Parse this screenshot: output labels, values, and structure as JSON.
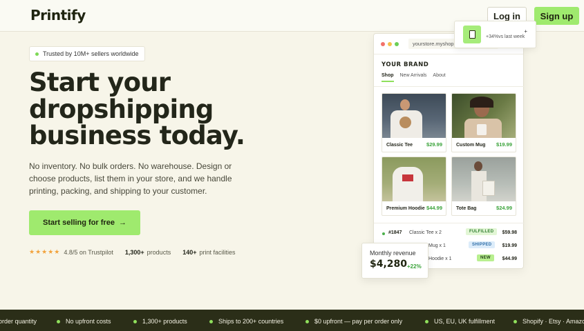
{
  "header": {
    "logo": "Printify",
    "login_label": "Log in",
    "signup_label": "Sign up"
  },
  "hero": {
    "trust_badge": "Trusted by 10M+ sellers worldwide",
    "headline_lines": [
      "Start your",
      "dropshipping",
      "business today."
    ],
    "subtext": "No inventory. No bulk orders. No warehouse. Design or choose products, list them in your store, and we handle printing, packing, and shipping to your customer.",
    "cta_label": "Start selling for free",
    "cta_arrow": "→",
    "stars": "★★★★★",
    "rating_text": "4.8/5 on Trustpilot",
    "products_count": "1,300+",
    "products_label": "products",
    "facilities_count": "140+",
    "facilities_label": "print facilities"
  },
  "notification": {
    "text": "+34%vs last week",
    "plus": "+"
  },
  "store": {
    "url": "yourstore.myshopify.",
    "brand": "YOUR BRAND",
    "tabs": [
      "Shop",
      "New Arrivals",
      "About"
    ],
    "products": [
      {
        "name": "Classic Tee",
        "price": "$29.99"
      },
      {
        "name": "Custom Mug",
        "price": "$19.99"
      },
      {
        "name": "Premium Hoodie",
        "price": "$44.99"
      },
      {
        "name": "Tote Bag",
        "price": "$24.99"
      }
    ],
    "orders": [
      {
        "id": "#1847",
        "item": "Classic Tee x 2",
        "status": "FULFILLED",
        "amount": "$59.98"
      },
      {
        "id": "",
        "item": "Mug x 1",
        "status": "SHIPPED",
        "amount": "$19.99"
      },
      {
        "id": "",
        "item": "Hoodie x 1",
        "status": "NEW",
        "amount": "$44.99"
      }
    ]
  },
  "revenue": {
    "label": "Monthly revenue",
    "value": "$4,280",
    "change": "+22%"
  },
  "ticker": [
    "order quantity",
    "No upfront costs",
    "1,300+ products",
    "Ships to 200+ countries",
    "$0 upfront — pay per order only",
    "US, EU, UK fulfillment",
    "Shopify · Etsy · Amazon"
  ],
  "colors": {
    "accent": "#9fea6e",
    "dark": "#23261a",
    "background": "#f7f5e9",
    "ticker_bg": "#2b2e18"
  }
}
